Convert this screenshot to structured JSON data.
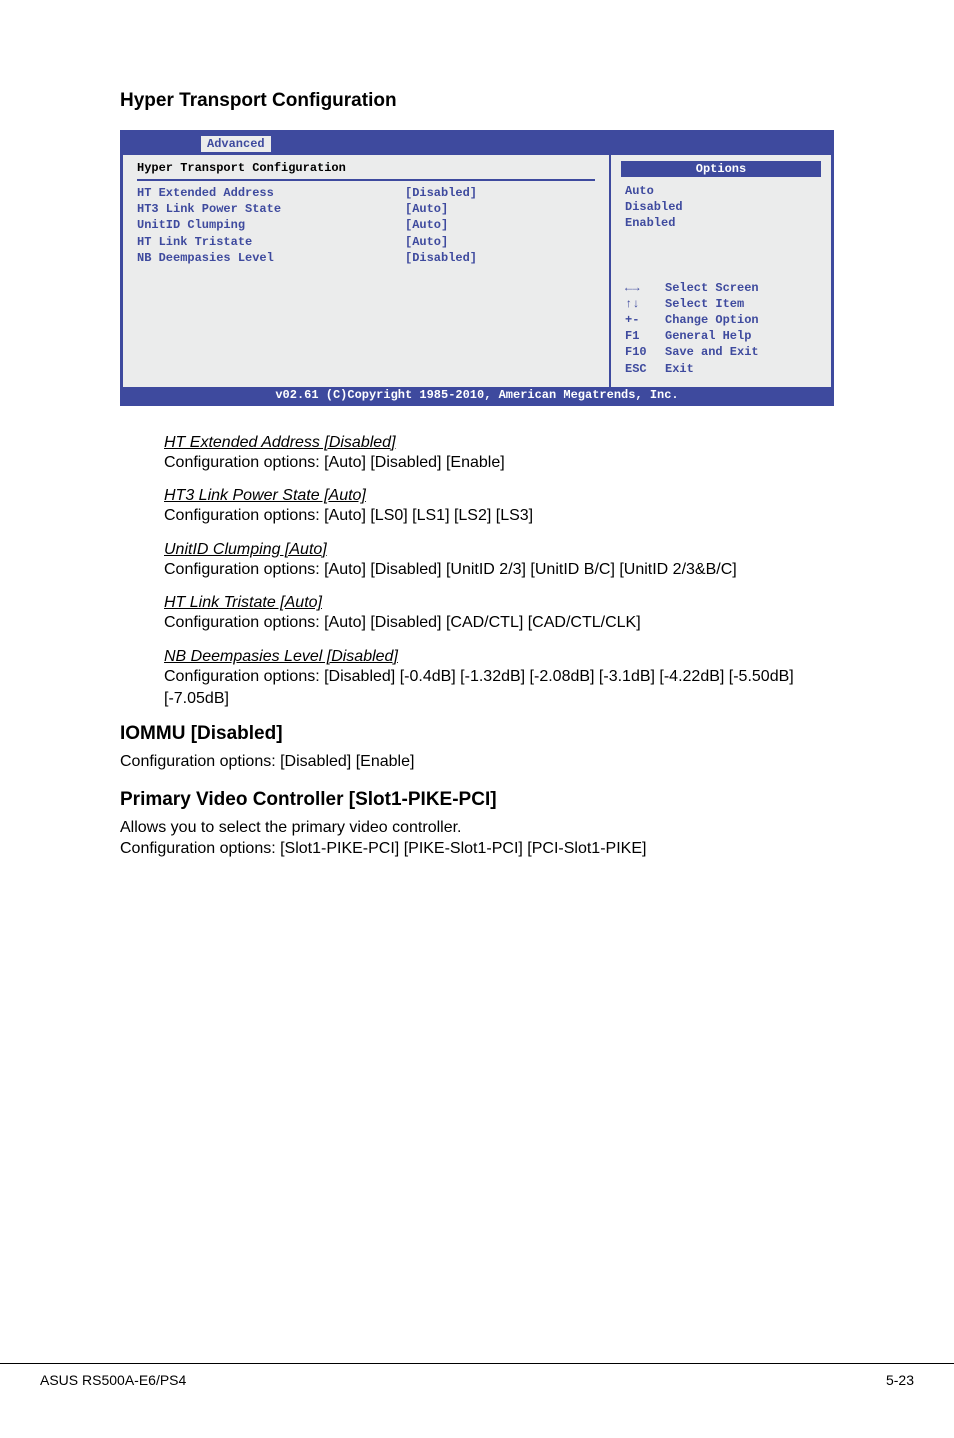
{
  "heading_main": "Hyper Transport Configuration",
  "bios": {
    "tab": "Advanced",
    "section_title": "Hyper Transport Configuration",
    "rows": [
      {
        "label": "HT Extended Address",
        "value": "[Disabled]"
      },
      {
        "label": "HT3 Link Power State",
        "value": "[Auto]"
      },
      {
        "label": "UnitID Clumping",
        "value": "[Auto]"
      },
      {
        "label": "HT Link Tristate",
        "value": "[Auto]"
      },
      {
        "label": "NB Deempasies Level",
        "value": "[Disabled]"
      }
    ],
    "options_heading": "Options",
    "options": [
      "Auto",
      "Disabled",
      "Enabled"
    ],
    "hints": [
      {
        "key": "←→",
        "label": "Select Screen"
      },
      {
        "key": "↑↓",
        "label": "Select Item"
      },
      {
        "key": "+-",
        "label": "Change Option"
      },
      {
        "key": "F1",
        "label": "General Help"
      },
      {
        "key": "F10",
        "label": "Save and Exit"
      },
      {
        "key": "ESC",
        "label": "Exit"
      }
    ],
    "footer": "v02.61 (C)Copyright 1985-2010, American Megatrends, Inc."
  },
  "opts": [
    {
      "title": "HT Extended Address [Disabled]",
      "desc": "Configuration options: [Auto] [Disabled] [Enable]"
    },
    {
      "title": "HT3 Link Power State [Auto]",
      "desc": "Configuration options: [Auto] [LS0] [LS1] [LS2] [LS3]"
    },
    {
      "title": "UnitID Clumping [Auto]",
      "desc": "Configuration options: [Auto] [Disabled] [UnitID 2/3] [UnitID B/C] [UnitID 2/3&B/C]"
    },
    {
      "title": "HT Link Tristate [Auto]",
      "desc": "Configuration options: [Auto] [Disabled] [CAD/CTL] [CAD/CTL/CLK]"
    },
    {
      "title": "NB Deempasies Level [Disabled]",
      "desc": "Configuration options: [Disabled] [-0.4dB] [-1.32dB] [-2.08dB] [-3.1dB] [-4.22dB] [-5.50dB] [-7.05dB]"
    }
  ],
  "sections": [
    {
      "title": "IOMMU [Disabled]",
      "body": "Configuration options: [Disabled] [Enable]"
    },
    {
      "title": "Primary Video Controller [Slot1-PIKE-PCI]",
      "body": "Allows you to select the primary video controller.\nConfiguration options: [Slot1-PIKE-PCI] [PIKE-Slot1-PCI] [PCI-Slot1-PIKE]"
    }
  ],
  "footer": {
    "left": "ASUS RS500A-E6/PS4",
    "right": "5-23"
  }
}
